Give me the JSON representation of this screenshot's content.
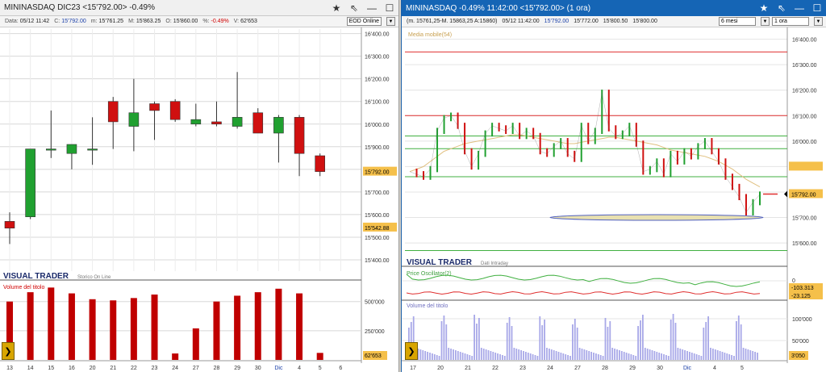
{
  "left": {
    "title": "MININASDAQ DIC23 <15'792.00> -0.49%",
    "info": [
      {
        "k": "Data:",
        "v": "05/12 11:42",
        "cls": "v-dark"
      },
      {
        "k": "C:",
        "v": "15'792.00",
        "cls": "v-blue"
      },
      {
        "k": "m:",
        "v": "15'761.25",
        "cls": "v-dark"
      },
      {
        "k": "M:",
        "v": "15'863.25",
        "cls": "v-dark"
      },
      {
        "k": "O:",
        "v": "15'860.00",
        "cls": "v-dark"
      },
      {
        "k": "%:",
        "v": "-0.49%",
        "cls": "v-red"
      },
      {
        "k": "V:",
        "v": "62'653",
        "cls": "v-dark"
      }
    ],
    "source_select": "EOD Online",
    "price_ticks": [
      "16'400.00",
      "16'300.00",
      "16'200.00",
      "16'100.00",
      "16'000.00",
      "15'900.00",
      "15'800.00",
      "15'700.00",
      "15'600.00",
      "15'500.00",
      "15'400.00"
    ],
    "last_price_label": "15'792.00",
    "low_marker_label": "15'542.88",
    "brand": "VISUAL TRADER",
    "brand_sub": "Storico On Line",
    "volume_title": "Volume del titolo",
    "volume_ticks": [
      "500'000",
      "250'000"
    ],
    "volume_last_label": "62'653",
    "x_labels": [
      "13",
      "14",
      "15",
      "16",
      "20",
      "21",
      "22",
      "23",
      "24",
      "27",
      "28",
      "29",
      "30",
      "Dic",
      "4",
      "5",
      "6"
    ],
    "colors": {
      "up": "#20a030",
      "down": "#d01010",
      "grid": "#d8d8d8",
      "volume": "#c00000",
      "last_label_bg": "#f5c04a"
    }
  },
  "right": {
    "title": "MININASDAQ -0.49% 11:42:00 <15'792.00> (1 ora)",
    "info": [
      {
        "k": "",
        "v": "(m. 15761,25-M. 15863,25 A:15860)",
        "cls": "v-dark"
      },
      {
        "k": "",
        "v": "05/12 11:42:00",
        "cls": "v-dark"
      },
      {
        "k": "",
        "v": "15'792.00",
        "cls": "v-blue"
      },
      {
        "k": "",
        "v": "15'772.00",
        "cls": "v-dark"
      },
      {
        "k": "",
        "v": "15'800.50",
        "cls": "v-dark"
      },
      {
        "k": "",
        "v": "15'800.00",
        "cls": "v-dark"
      }
    ],
    "period_select": "6 mesi",
    "interval_select": "1 ora",
    "ma_label": "Media mobile(54)",
    "price_ticks": [
      "16'400.00",
      "16'300.00",
      "16'200.00",
      "16'100.00",
      "16'000.00",
      "15'900.00",
      "15'800.00",
      "15'700.00",
      "15'600.00"
    ],
    "last_price_label": "15'792.00",
    "brand": "VISUAL TRADER",
    "brand_sub": "Dati Intraday",
    "osc_title": "Price Oscillator(2)",
    "osc_label_a": "-103.313",
    "osc_label_b": "-23.125",
    "osc_zero": "0",
    "volume_title": "Volume del titolo",
    "volume_ticks": [
      "100'000",
      "50'000"
    ],
    "volume_last_label": "3'050",
    "x_labels": [
      "17",
      "20",
      "21",
      "22",
      "23",
      "24",
      "27",
      "28",
      "29",
      "30",
      "Dic",
      "4",
      "5"
    ],
    "colors": {
      "resistance": "#e03030",
      "support": "#40b040",
      "ma": "#e0c080",
      "candle_up": "#20a030",
      "candle_down": "#d01010",
      "volume": "#a8a8e8",
      "osc": "#40b040",
      "osc2": "#e03030"
    }
  },
  "chart_data": [
    {
      "type": "candlestick",
      "title": "MININASDAQ DIC23",
      "x": [
        "13",
        "14",
        "15",
        "16",
        "20",
        "21",
        "22",
        "23",
        "24",
        "27",
        "28",
        "29",
        "30",
        "Dic",
        "4",
        "5"
      ],
      "open": [
        15570,
        15590,
        15890,
        15870,
        15890,
        16100,
        15990,
        16090,
        16100,
        16000,
        16010,
        15990,
        16050,
        15960,
        16030,
        15860
      ],
      "high": [
        15610,
        15880,
        16060,
        15910,
        16030,
        16120,
        16200,
        16100,
        16110,
        16090,
        16100,
        16230,
        16070,
        16040,
        16040,
        15870
      ],
      "low": [
        15470,
        15580,
        15850,
        15800,
        15820,
        15890,
        15880,
        15930,
        16010,
        15990,
        15990,
        15980,
        15960,
        15830,
        15770,
        15770
      ],
      "close": [
        15540,
        15890,
        15890,
        15910,
        15890,
        16010,
        16050,
        16060,
        16020,
        16020,
        16000,
        16030,
        15960,
        16030,
        15870,
        15790
      ],
      "volume": [
        500000,
        580000,
        620000,
        570000,
        520000,
        510000,
        530000,
        560000,
        55000,
        270000,
        500000,
        550000,
        580000,
        610000,
        570000,
        60000
      ],
      "ylim": [
        15350,
        16420
      ],
      "volume_ylim": [
        0,
        650000
      ]
    },
    {
      "type": "line",
      "title": "MININASDAQ (1 ora)",
      "x_categories": [
        "17",
        "20",
        "21",
        "22",
        "23",
        "24",
        "27",
        "28",
        "29",
        "30",
        "Dic",
        "4",
        "5"
      ],
      "price": [
        15880,
        15870,
        15860,
        15890,
        16040,
        16090,
        16100,
        16060,
        15960,
        15900,
        15950,
        16030,
        16060,
        16050,
        16040,
        16060,
        16020,
        16040,
        16020,
        15960,
        15950,
        15980,
        16000,
        15950,
        15930,
        16060,
        16000,
        16040,
        16190,
        16050,
        16020,
        16030,
        16060,
        15990,
        15880,
        15890,
        15920,
        15870,
        15950,
        15920,
        15960,
        15940,
        15980,
        16000,
        15960,
        15920,
        15860,
        15820,
        15780,
        15720,
        15760,
        15790
      ],
      "moving_average_54": [
        15880,
        15890,
        15900,
        15920,
        15940,
        15960,
        15970,
        15980,
        15990,
        15995,
        16000,
        16005,
        16010,
        16015,
        16020,
        16025,
        16025,
        16020,
        16015,
        16010,
        16005,
        16000,
        15995,
        15990,
        15990,
        15995,
        16000,
        16005,
        16010,
        16015,
        16015,
        16010,
        16005,
        16000,
        15995,
        15990,
        15985,
        15975,
        15965,
        15960,
        15955,
        15950,
        15945,
        15940,
        15930,
        15920,
        15905,
        15890,
        15870,
        15850,
        15835,
        15820
      ],
      "resistance_lines": [
        16350,
        16100
      ],
      "support_lines": [
        16020,
        15970,
        15860,
        15570
      ],
      "ylim": [
        15540,
        16440
      ]
    }
  ]
}
